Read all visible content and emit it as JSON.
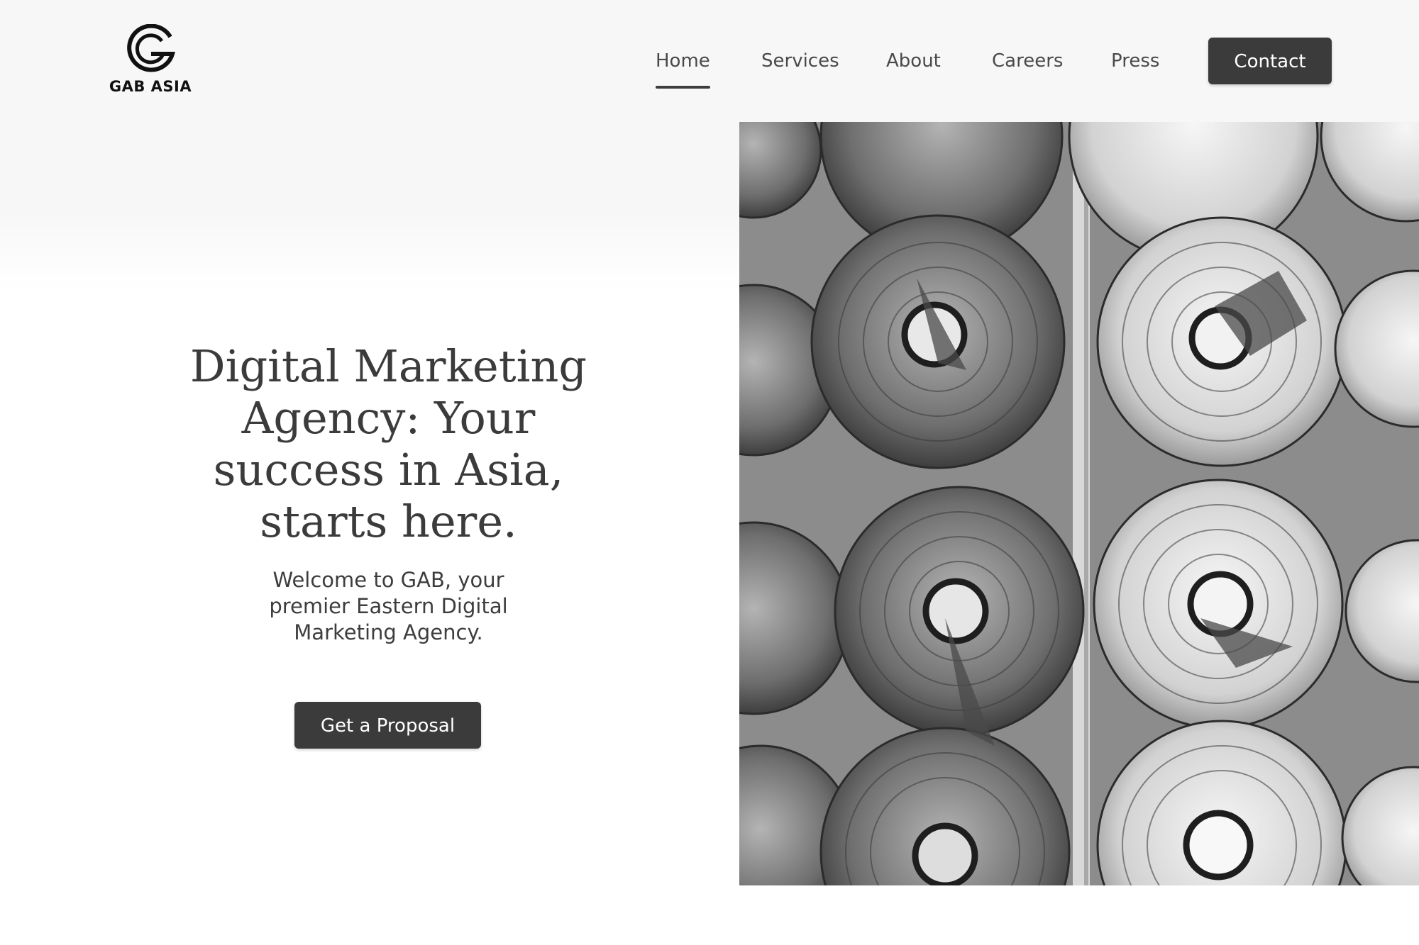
{
  "brand": {
    "name": "GAB ASIA",
    "logo_icon": "g-logo-icon"
  },
  "nav": {
    "items": [
      {
        "label": "Home",
        "active": true
      },
      {
        "label": "Services",
        "active": false
      },
      {
        "label": "About",
        "active": false
      },
      {
        "label": "Careers",
        "active": false
      },
      {
        "label": "Press",
        "active": false
      }
    ],
    "contact_label": "Contact"
  },
  "hero": {
    "title": "Digital Marketing Agency: Your success in Asia, starts here.",
    "subtitle": "Welcome to GAB, your premier Eastern Digital Marketing Agency.",
    "cta_label": "Get a Proposal",
    "image": "paper-lanterns-photo"
  },
  "colors": {
    "button_bg": "#3b3b3b",
    "button_text": "#ffffff",
    "header_bg": "#f7f7f7",
    "text": "#3d3d3d"
  }
}
